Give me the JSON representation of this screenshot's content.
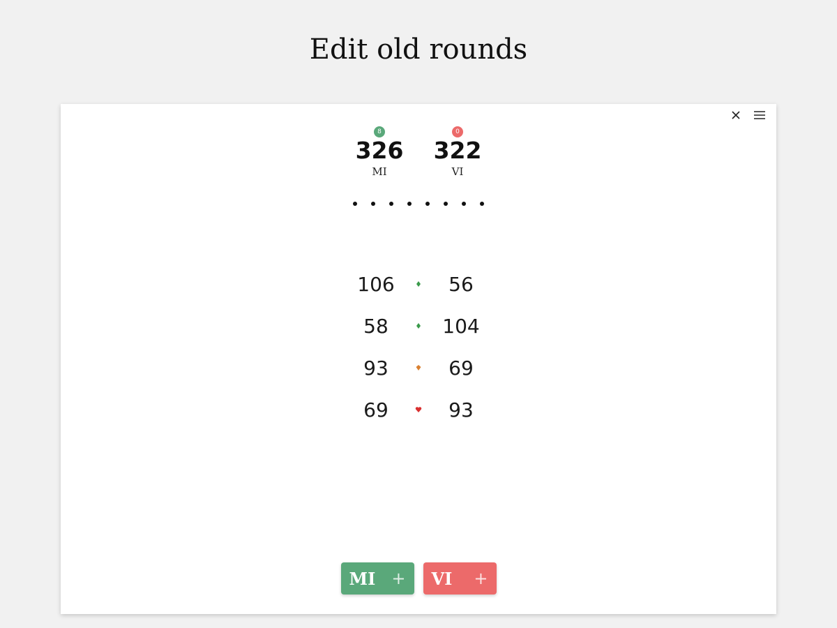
{
  "page": {
    "title": "Edit old rounds"
  },
  "colors": {
    "green": "#5aa87a",
    "red": "#ec6a6a",
    "marker_green": "#3a9a4a",
    "marker_orange": "#d98030",
    "marker_red": "#d93030"
  },
  "toolbar": {
    "close_icon": "close-icon",
    "menu_icon": "menu-icon"
  },
  "teams": [
    {
      "name": "MI",
      "total": "326",
      "badge": "8",
      "color": "#5aa87a"
    },
    {
      "name": "VI",
      "total": "322",
      "badge": "0",
      "color": "#ec6a6a"
    }
  ],
  "dot_count": 8,
  "rounds": [
    {
      "left": "106",
      "right": "56",
      "marker": "green"
    },
    {
      "left": "58",
      "right": "104",
      "marker": "green"
    },
    {
      "left": "93",
      "right": "69",
      "marker": "orange"
    },
    {
      "left": "69",
      "right": "93",
      "marker": "red"
    }
  ],
  "buttons": [
    {
      "label": "MI",
      "plus": "+",
      "color": "#5aa87a"
    },
    {
      "label": "VI",
      "plus": "+",
      "color": "#ec6a6a"
    }
  ]
}
